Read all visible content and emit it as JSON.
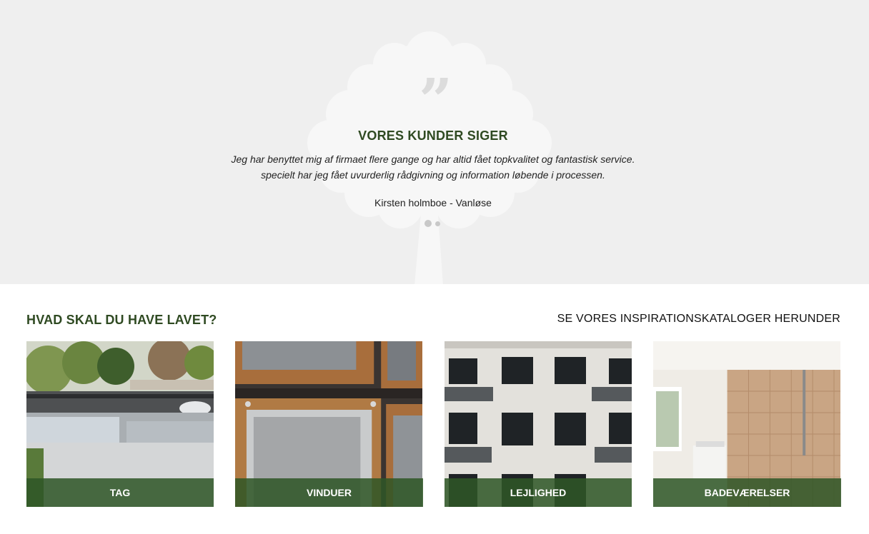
{
  "testimonial": {
    "title_strong": "VORES KUNDER",
    "title_rest": "SIGER",
    "quote_line1": "Jeg har benyttet mig af firmaet flere gange og har altid fået topkvalitet og fantastisk service.",
    "quote_line2": "specielt har jeg fået uvurderlig rådgivning og information løbende i processen.",
    "author": "Kirsten holmboe - Vanløse",
    "slide_count": 2,
    "active_slide": 1
  },
  "services": {
    "title": "HVAD SKAL DU HAVE LAVET?",
    "link_text": "SE VORES INSPIRATIONSKATALOGER HERUNDER",
    "tiles": [
      {
        "label": "TAG",
        "photo": "flat-roof-with-skylights"
      },
      {
        "label": "VINDUER",
        "photo": "wooden-window-frames"
      },
      {
        "label": "LEJLIGHED",
        "photo": "apartment-facade-with-balconies"
      },
      {
        "label": "BADEVÆRELSER",
        "photo": "tiled-bathroom-with-shower"
      }
    ]
  },
  "colors": {
    "brand_green": "#2f4a22",
    "hero_background": "#efefef",
    "tile_label_background": "#2e5626"
  }
}
